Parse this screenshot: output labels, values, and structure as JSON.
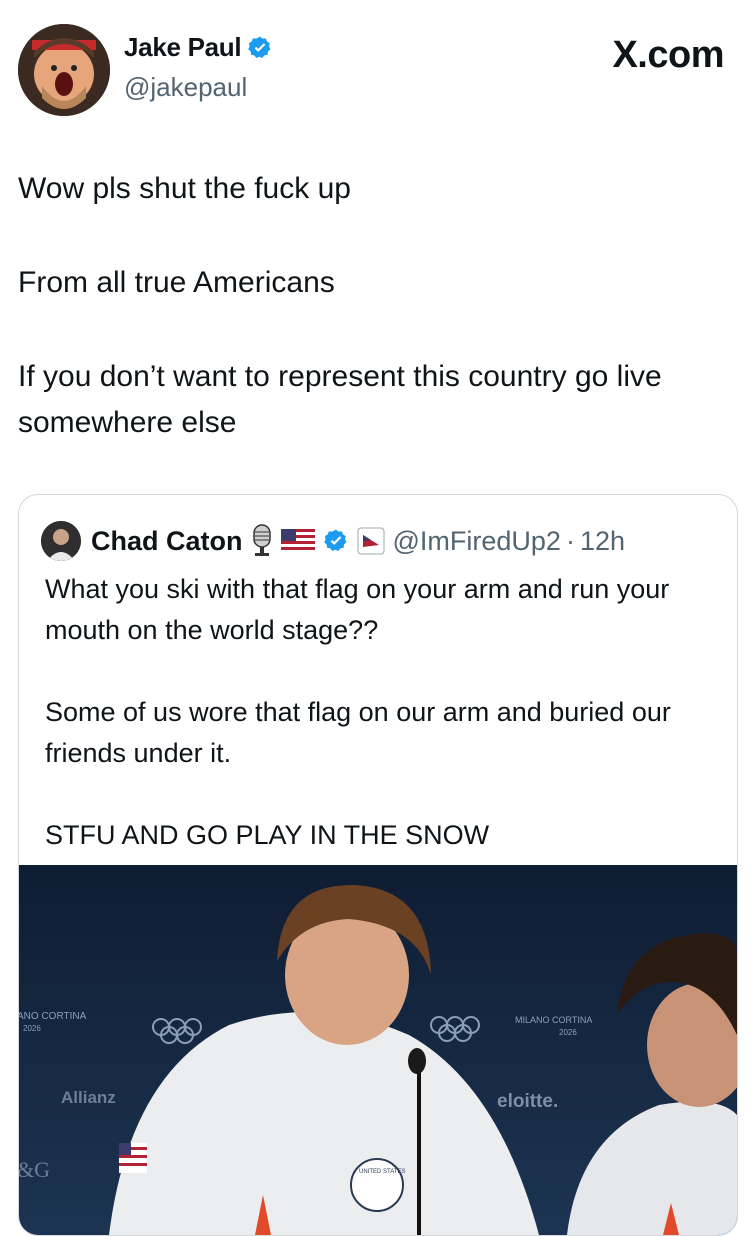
{
  "author": {
    "name": "Jake Paul",
    "handle": "@jakepaul",
    "verified_icon": "verified-badge-icon",
    "accent": "#1d9bf0"
  },
  "source_logo": "X.com",
  "tweet": {
    "lines": [
      "Wow pls shut the fuck up",
      "From all true Americans",
      "If you don’t want to represent this country go live somewhere else"
    ]
  },
  "quoted": {
    "name": "Chad Caton",
    "icons": [
      "microphone-icon",
      "us-flag-icon",
      "verified-badge-icon",
      "flag-badge-icon"
    ],
    "handle": "@ImFiredUp2",
    "separator": "·",
    "time": "12h",
    "lines": [
      "What you ski with that flag on your arm and run your mouth on the world stage??",
      "Some of us wore that flag on our arm and buried our friends under it.",
      "STFU AND GO PLAY IN THE SNOW"
    ],
    "image_text": {
      "left_backdrop": "ANO CORTINA",
      "left_backdrop_year": "2026",
      "right_backdrop": "MILANO CORTINA",
      "right_backdrop_year": "2026",
      "sponsor_left": "Allianz",
      "sponsor_right": "eloitte.",
      "corner": "&G",
      "badge": "UNITED STATES"
    }
  }
}
